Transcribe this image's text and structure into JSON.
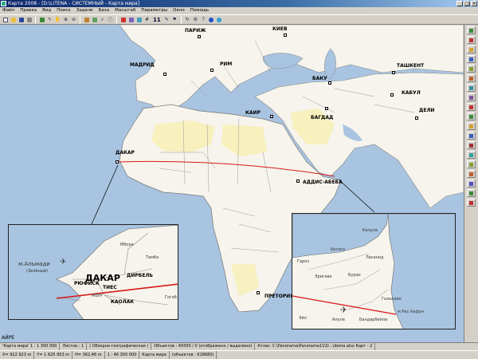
{
  "window": {
    "title": "Карта 2008 - [D:\\LITENA - СИСТЕМНЫЙ - Карта мира]",
    "controls": [
      "_",
      "□",
      "×"
    ]
  },
  "menu": [
    "Файл",
    "Правка",
    "Вид",
    "Поиск",
    "Задачи",
    "База",
    "Масштаб",
    "Параметры",
    "Окно",
    "Помощь"
  ],
  "toolbar": {
    "scale_number": "11"
  },
  "map": {
    "labels": {
      "paris": "ПАРИЖ",
      "kiev": "КИЕВ",
      "madrid": "МАДРИД",
      "rome": "РИМ",
      "tashkent": "ТАШКЕНТ",
      "baku": "БАКУ",
      "kabul": "КАБУЛ",
      "delhi": "ДЕЛИ",
      "baghdad": "БАГДАД",
      "cairo": "КАИР",
      "dakar": "ДАКАР",
      "addis": "АДДИС-АБЕБА",
      "pretoria": "ПРЕТОРИЯ",
      "bottom_left": "АЙРЕ"
    },
    "colors": {
      "water": "#a8c4e0",
      "land": "#f6f4ec",
      "desert": "#f8f0b8",
      "route": "#d81818"
    }
  },
  "inset_left": {
    "labels": {
      "almadi": "м.Альмади",
      "almadi_sub": "(Зелёный)",
      "rufisk": "РЮФИСК",
      "dakar": "ДАКАР",
      "ties": "ТИЕС",
      "mbur": "МБУР",
      "dirbel": "ДИРБЕЛЬ",
      "kaolak": "КАОЛАК",
      "mbore": "Мборе",
      "tambi": "Тамба",
      "gorodok": "Гогоб"
    }
  },
  "inset_right": {
    "labels": {
      "cape": "м.Рас-Хафун",
      "calula": "Калула",
      "bosaso": "Босасо",
      "garoe": "Гароэ",
      "lasanod": "Ласанод",
      "erigavo": "Эригаво",
      "burao": "Бурао",
      "galkayo": "Галькайо",
      "eyl": "Эйл",
      "alula": "Алула",
      "bandar": "Бандарбейла"
    }
  },
  "status": {
    "map_name": "'Карта мира' 1 : 1 300 000",
    "sheets": "Листов : 1",
    "projection": "( Обзорно-географическая )",
    "objects": "Объектов : 49393 / 0 (отображено / выделено)",
    "atlas": "Атлас: C:\\Panorama\\Panorama11\\D...\\demo.alsx  Карт - 2"
  },
  "coords": {
    "x": "X= 922 923 m",
    "y": "Y= 1 625 953 m",
    "h": "H= 362,46 m",
    "scale": "1 : 46 300 000",
    "map": "Карта мира",
    "count": "(объектов : 618680)"
  }
}
